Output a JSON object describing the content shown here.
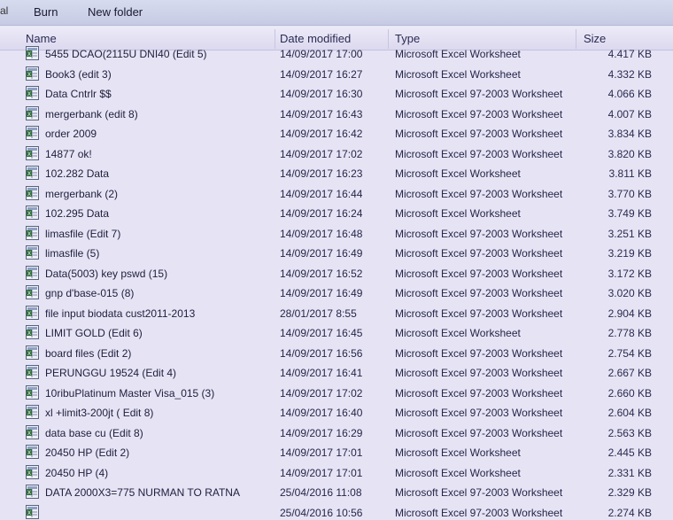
{
  "toolbar": {
    "burn_label": "Burn",
    "new_folder_label": "New folder"
  },
  "columns": {
    "name": "Name",
    "date_modified": "Date modified",
    "type": "Type",
    "size": "Size"
  },
  "icon": "excel-file-icon",
  "files": [
    {
      "name": "5455 DCAO(2115U DNI40 (Edit 5)",
      "date": "14/09/2017 17:00",
      "type": "Microsoft Excel Worksheet",
      "size": "4.417 KB"
    },
    {
      "name": "Book3 (edit 3)",
      "date": "14/09/2017 16:27",
      "type": "Microsoft Excel Worksheet",
      "size": "4.332 KB"
    },
    {
      "name": "Data Cntrlr $$",
      "date": "14/09/2017 16:30",
      "type": "Microsoft Excel 97-2003 Worksheet",
      "size": "4.066 KB"
    },
    {
      "name": "mergerbank (edit 8)",
      "date": "14/09/2017 16:43",
      "type": "Microsoft Excel 97-2003 Worksheet",
      "size": "4.007 KB"
    },
    {
      "name": "order 2009",
      "date": "14/09/2017 16:42",
      "type": "Microsoft Excel 97-2003 Worksheet",
      "size": "3.834 KB"
    },
    {
      "name": "14877 ok!",
      "date": "14/09/2017 17:02",
      "type": "Microsoft Excel 97-2003 Worksheet",
      "size": "3.820 KB"
    },
    {
      "name": "102.282 Data",
      "date": "14/09/2017 16:23",
      "type": "Microsoft Excel Worksheet",
      "size": "3.811 KB"
    },
    {
      "name": "mergerbank (2)",
      "date": "14/09/2017 16:44",
      "type": "Microsoft Excel 97-2003 Worksheet",
      "size": "3.770 KB"
    },
    {
      "name": "102.295 Data",
      "date": "14/09/2017 16:24",
      "type": "Microsoft Excel Worksheet",
      "size": "3.749 KB"
    },
    {
      "name": "limasfile (Edit 7)",
      "date": "14/09/2017 16:48",
      "type": "Microsoft Excel 97-2003 Worksheet",
      "size": "3.251 KB"
    },
    {
      "name": "limasfile (5)",
      "date": "14/09/2017 16:49",
      "type": "Microsoft Excel 97-2003 Worksheet",
      "size": "3.219 KB"
    },
    {
      "name": "Data(5003) key pswd (15)",
      "date": "14/09/2017 16:52",
      "type": "Microsoft Excel 97-2003 Worksheet",
      "size": "3.172 KB"
    },
    {
      "name": "gnp d'base-015 (8)",
      "date": "14/09/2017 16:49",
      "type": "Microsoft Excel 97-2003 Worksheet",
      "size": "3.020 KB"
    },
    {
      "name": "file input biodata cust2011-2013",
      "date": "28/01/2017 8:55",
      "type": "Microsoft Excel 97-2003 Worksheet",
      "size": "2.904 KB"
    },
    {
      "name": "LIMIT GOLD (Edit 6)",
      "date": "14/09/2017 16:45",
      "type": "Microsoft Excel Worksheet",
      "size": "2.778 KB"
    },
    {
      "name": "board files (Edit 2)",
      "date": "14/09/2017 16:56",
      "type": "Microsoft Excel 97-2003 Worksheet",
      "size": "2.754 KB"
    },
    {
      "name": "PERUNGGU 19524 (Edit 4)",
      "date": "14/09/2017 16:41",
      "type": "Microsoft Excel 97-2003 Worksheet",
      "size": "2.667 KB"
    },
    {
      "name": "10ribuPlatinum Master Visa_015 (3)",
      "date": "14/09/2017 17:02",
      "type": "Microsoft Excel 97-2003 Worksheet",
      "size": "2.660 KB"
    },
    {
      "name": "xl +limit3-200jt ( Edit 8)",
      "date": "14/09/2017 16:40",
      "type": "Microsoft Excel 97-2003 Worksheet",
      "size": "2.604 KB"
    },
    {
      "name": "data base cu (Edit 8)",
      "date": "14/09/2017 16:29",
      "type": "Microsoft Excel 97-2003 Worksheet",
      "size": "2.563 KB"
    },
    {
      "name": "20450 HP (Edit 2)",
      "date": "14/09/2017 17:01",
      "type": "Microsoft Excel Worksheet",
      "size": "2.445 KB"
    },
    {
      "name": "20450 HP (4)",
      "date": "14/09/2017 17:01",
      "type": "Microsoft Excel Worksheet",
      "size": "2.331 KB"
    },
    {
      "name": "DATA 2000X3=775 NURMAN TO RATNA",
      "date": "25/04/2016 11:08",
      "type": "Microsoft Excel 97-2003 Worksheet",
      "size": "2.329 KB"
    },
    {
      "name": "",
      "date": "25/04/2016 10:56",
      "type": "Microsoft Excel 97-2003 Worksheet",
      "size": "2.274 KB"
    }
  ]
}
